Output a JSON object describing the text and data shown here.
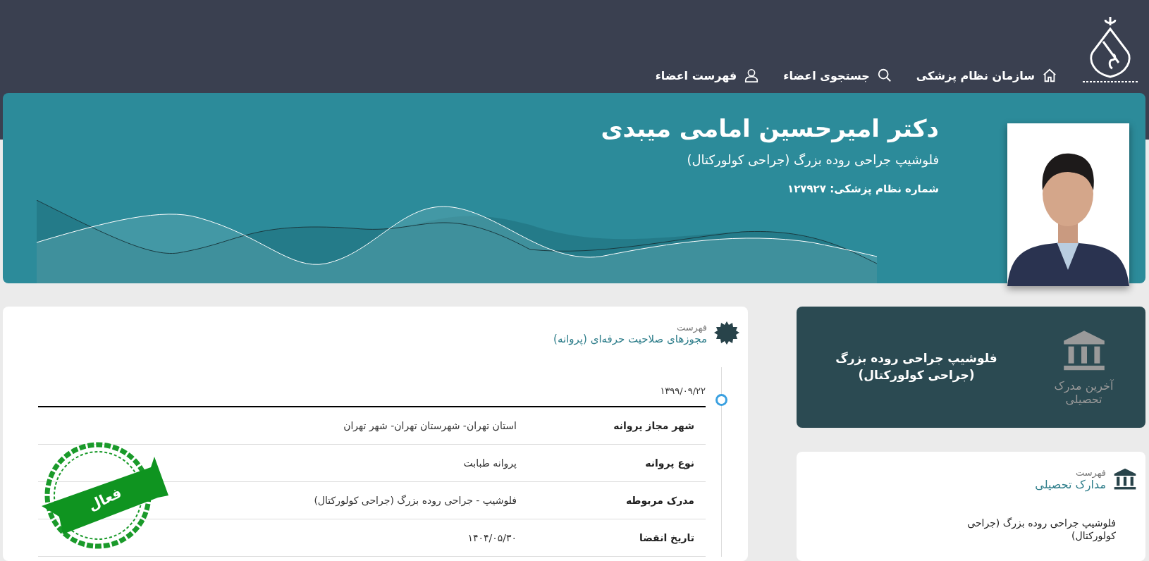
{
  "header": {
    "logo": {
      "kind": "emblem"
    },
    "nav": [
      {
        "kind": "home",
        "label": "سازمان نظام پزشکی"
      },
      {
        "kind": "search",
        "label": "جستجوی اعضاء"
      },
      {
        "kind": "user",
        "label": "فهرست اعضاء"
      }
    ]
  },
  "profile": {
    "name": "دکتر امیرحسین امامی میبدی",
    "specialty": "فلوشیپ جراحی روده بزرگ (جراحی کولورکتال)",
    "council_number": "شماره نظام پزشکی: ۱۲۷۹۲۷"
  },
  "licenses": {
    "caption": "فهرست",
    "title": "مجوزهای صلاحیت حرفه‌ای (پروانه)",
    "entries": [
      {
        "date": "۱۳۹۹/۰۹/۲۲",
        "stamp": "فعال",
        "rows": [
          {
            "label": "شهر مجاز پروانه",
            "value": "استان تهران- شهرستان تهران- شهر تهران"
          },
          {
            "label": "نوع پروانه",
            "value": "پروانه طبابت"
          },
          {
            "label": "مدرک مربوطه",
            "value": "فلوشیپ - جراحی روده بزرگ (جراحی کولورکتال)"
          },
          {
            "label": "تاریخ انقضا",
            "value": "۱۴۰۴/۰۵/۳۰"
          }
        ]
      }
    ]
  },
  "latest_degree": {
    "label": "آخرین مدرک تحصیلی",
    "value": "فلوشیپ جراحی روده بزرگ (جراحی کولورکتال)"
  },
  "degrees": {
    "caption": "فهرست",
    "title": "مدارک تحصیلی",
    "items": [
      "فلوشیپ جراحی روده بزرگ (جراحی کولورکتال)"
    ]
  }
}
